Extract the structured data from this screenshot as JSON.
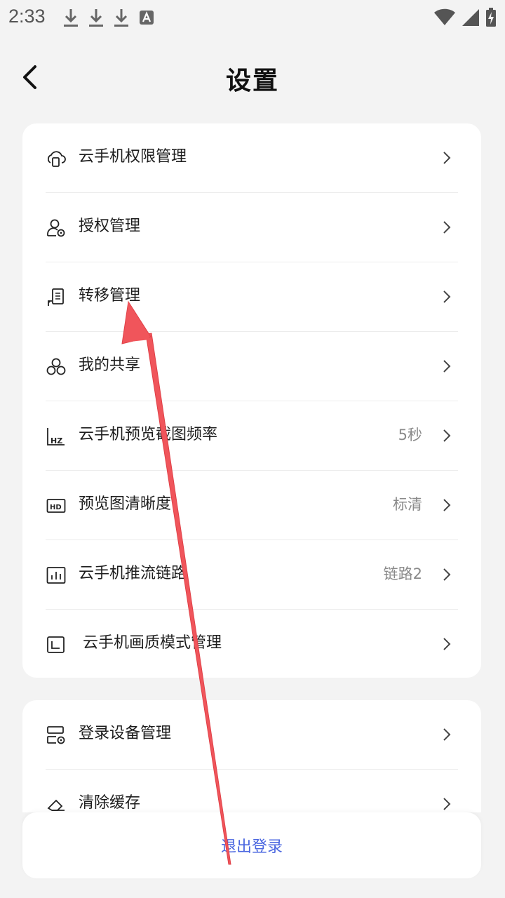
{
  "status_bar": {
    "time": "2:33",
    "left_icons": [
      "download-icon",
      "download-icon",
      "download-icon",
      "font-a-icon"
    ],
    "right_icons": [
      "wifi-icon",
      "signal-icon",
      "battery-charging-icon"
    ]
  },
  "header": {
    "title": "设置",
    "back_icon": "chevron-left-icon"
  },
  "settings_group_1": [
    {
      "name": "cloud-phone-permission",
      "icon": "cloud-phone-icon",
      "label": "云手机权限管理",
      "value": ""
    },
    {
      "name": "authorization",
      "icon": "user-settings-icon",
      "label": "授权管理",
      "value": ""
    },
    {
      "name": "transfer",
      "icon": "transfer-document-icon",
      "label": "转移管理",
      "value": ""
    },
    {
      "name": "my-share",
      "icon": "share-nodes-icon",
      "label": "我的共享",
      "value": ""
    },
    {
      "name": "preview-capture-frequency",
      "icon": "hz-icon",
      "label": "云手机预览截图频率",
      "value": "5秒"
    },
    {
      "name": "preview-clarity",
      "icon": "hd-icon",
      "label": "预览图清晰度",
      "value": "标清"
    },
    {
      "name": "stream-link",
      "icon": "bar-chart-icon",
      "label": "云手机推流链路",
      "value": "链路2"
    },
    {
      "name": "quality-mode",
      "icon": "quality-frame-icon",
      "label": "云手机画质模式管理",
      "value": ""
    }
  ],
  "settings_group_2": [
    {
      "name": "login-device",
      "icon": "device-settings-icon",
      "label": "登录设备管理",
      "value": ""
    },
    {
      "name": "clear-cache",
      "icon": "eraser-icon",
      "label": "清除缓存",
      "value": ""
    }
  ],
  "logout": {
    "label": "退出登录"
  },
  "colors": {
    "accent": "#4a66e0",
    "annotation_arrow": "#f0555b",
    "background": "#f3f3f3"
  }
}
